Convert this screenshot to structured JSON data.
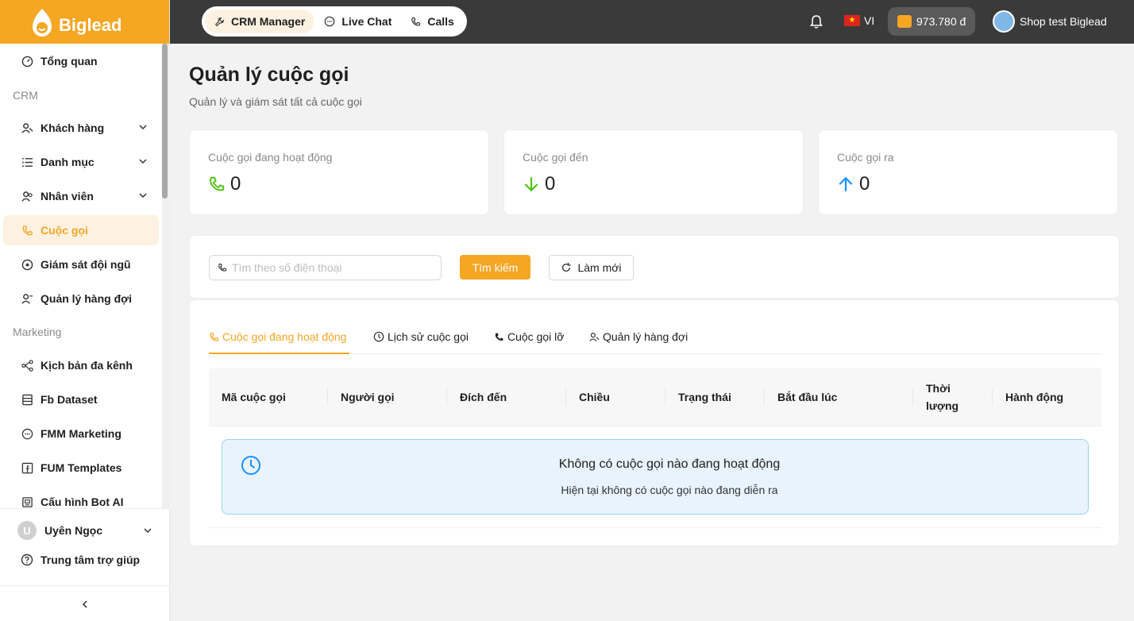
{
  "brand": {
    "name": "Biglead",
    "color": "#f5a623"
  },
  "sidebar": {
    "items": [
      {
        "label": "Tổng quan",
        "icon": "dashboard-icon"
      },
      {
        "label": "Khách hàng",
        "icon": "users-icon"
      },
      {
        "label": "Danh mục",
        "icon": "list-icon"
      },
      {
        "label": "Nhân viên",
        "icon": "staff-icon"
      },
      {
        "label": "Cuộc gọi",
        "icon": "phone-icon",
        "active": true
      },
      {
        "label": "Giám sát đội ngũ",
        "icon": "monitor-icon"
      },
      {
        "label": "Quản lý hàng đợi",
        "icon": "queue-icon"
      },
      {
        "label": "Kịch bản đa kênh",
        "icon": "flow-icon"
      },
      {
        "label": "Fb Dataset",
        "icon": "dataset-icon"
      },
      {
        "label": "FMM Marketing",
        "icon": "chat-icon"
      },
      {
        "label": "FUM Templates",
        "icon": "facebook-icon"
      },
      {
        "label": "Cấu hình Bot AI",
        "icon": "bot-icon"
      }
    ],
    "sections": {
      "crm": "CRM",
      "marketing": "Marketing"
    },
    "user": {
      "initial": "U",
      "name": "Uyên Ngọc"
    },
    "help": "Trung tâm trợ giúp"
  },
  "topbar": {
    "apps": [
      "CRM Manager",
      "Live Chat",
      "Calls"
    ],
    "lang": "VI",
    "balance": "973.780 đ",
    "shop": "Shop test Biglead"
  },
  "page": {
    "title": "Quản lý cuộc gọi",
    "subtitle": "Quản lý và giám sát tất cả cuộc gọi"
  },
  "stats": [
    {
      "label": "Cuộc gọi đang hoạt động",
      "value": "0",
      "color": "#52c41a"
    },
    {
      "label": "Cuộc gọi đến",
      "value": "0",
      "color": "#52c41a"
    },
    {
      "label": "Cuộc gọi ra",
      "value": "0",
      "color": "#1890ff"
    }
  ],
  "search": {
    "placeholder": "Tìm theo số điện thoại",
    "search_label": "Tìm kiếm",
    "refresh_label": "Làm mới"
  },
  "tabs": [
    {
      "label": "Cuộc gọi đang hoạt động",
      "active": true
    },
    {
      "label": "Lịch sử cuộc gọi"
    },
    {
      "label": "Cuộc gọi lỡ"
    },
    {
      "label": "Quản lý hàng đợi"
    }
  ],
  "table": {
    "columns": [
      "Mã cuộc gọi",
      "Người gọi",
      "Đích đến",
      "Chiều",
      "Trạng thái",
      "Bắt đầu lúc",
      "Thời lượng",
      "Hành động"
    ]
  },
  "empty": {
    "title": "Không có cuộc gọi nào đang hoạt động",
    "subtitle": "Hiện tại không có cuộc gọi nào đang diễn ra"
  }
}
